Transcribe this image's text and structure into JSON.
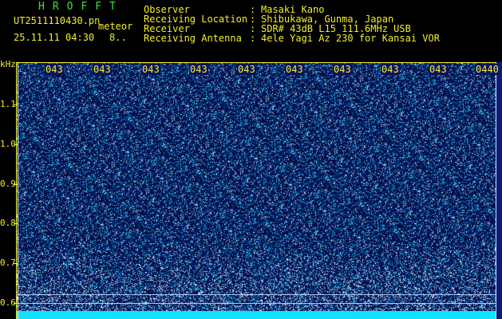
{
  "header": {
    "brand": "HROFFT",
    "file": "UT2511110430.pn",
    "mode": "meteor",
    "datetime": "25.11.11 04:30",
    "count": "8.."
  },
  "meta": [
    {
      "label": "Observer",
      "sep": ":",
      "value": "Masaki Kano"
    },
    {
      "label": "Receiving Location",
      "sep": ":",
      "value": "Shibukawa, Gunma, Japan"
    },
    {
      "label": "Receiver",
      "sep": ":",
      "value": "SDR# 43dB L15 111.6MHz USB"
    },
    {
      "label": "Receiving Antenna",
      "sep": ":",
      "value": "4ele Yagi Az 230 for Kansai VOR"
    }
  ],
  "y_axis": {
    "unit": "kHz",
    "ticks": [
      "1.1",
      "1.0",
      "0.9",
      "0.8",
      "0.7",
      "0.6"
    ]
  },
  "x_axis": {
    "labels": [
      "043",
      "043",
      "043",
      "043",
      "043",
      "043",
      "043",
      "043",
      "043",
      "0440"
    ]
  },
  "colors": {
    "text_yellow": "#f2ee2a",
    "brand_green": "#39e23b",
    "background": "#000000",
    "spectrum_base": "#050832",
    "bottom_band": "#10e2ff"
  }
}
